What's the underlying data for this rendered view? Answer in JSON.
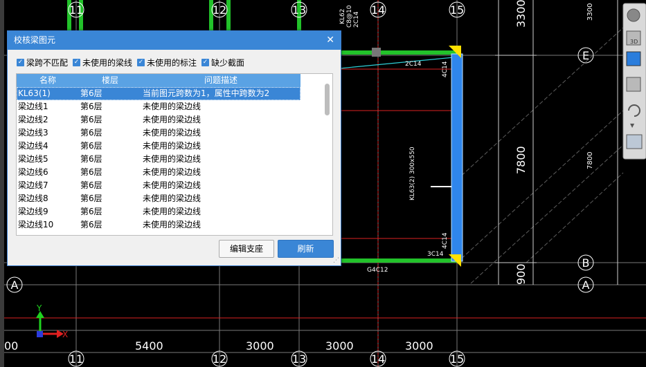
{
  "dialog": {
    "title": "校核梁图元",
    "checks": [
      {
        "label": "梁跨不匹配",
        "checked": true
      },
      {
        "label": "未使用的梁线",
        "checked": true
      },
      {
        "label": "未使用的标注",
        "checked": true
      },
      {
        "label": "缺少截面",
        "checked": true
      }
    ],
    "columns": [
      "名称",
      "楼层",
      "问题描述"
    ],
    "rows": [
      {
        "name": "KL63(1)",
        "floor": "第6层",
        "desc": "当前图元跨数为1，属性中跨数为2",
        "selected": true
      },
      {
        "name": "梁边线1",
        "floor": "第6层",
        "desc": "未使用的梁边线"
      },
      {
        "name": "梁边线2",
        "floor": "第6层",
        "desc": "未使用的梁边线"
      },
      {
        "name": "梁边线3",
        "floor": "第6层",
        "desc": "未使用的梁边线"
      },
      {
        "name": "梁边线4",
        "floor": "第6层",
        "desc": "未使用的梁边线"
      },
      {
        "name": "梁边线5",
        "floor": "第6层",
        "desc": "未使用的梁边线"
      },
      {
        "name": "梁边线6",
        "floor": "第6层",
        "desc": "未使用的梁边线"
      },
      {
        "name": "梁边线7",
        "floor": "第6层",
        "desc": "未使用的梁边线"
      },
      {
        "name": "梁边线8",
        "floor": "第6层",
        "desc": "未使用的梁边线"
      },
      {
        "name": "梁边线9",
        "floor": "第6层",
        "desc": "未使用的梁边线"
      },
      {
        "name": "梁边线10",
        "floor": "第6层",
        "desc": "未使用的梁边线"
      }
    ],
    "buttons": {
      "edit": "编辑支座",
      "refresh": "刷新"
    }
  },
  "cad": {
    "axes_top": [
      "11",
      "12",
      "13",
      "14",
      "15"
    ],
    "axes_bottom": [
      "11",
      "12",
      "13",
      "14",
      "15"
    ],
    "axes_right": [
      "E",
      "B",
      "A"
    ],
    "axis_left": "A",
    "dims_bottom": [
      "00",
      "5400",
      "3000",
      "3000",
      "3000"
    ],
    "dims_right": [
      "3300",
      "7800",
      "900"
    ],
    "dims_right_small": [
      "3300",
      "7800"
    ],
    "beam_label_main": "KL63(2) 300x550",
    "beam_label_small": [
      "2C14",
      "4C14",
      "4C14",
      "3C14",
      "G4C12",
      "3C14"
    ],
    "top_labels": [
      "KL62",
      "C8@10",
      "2C14"
    ],
    "coord_y": "Y",
    "coord_x": "X"
  },
  "toolbar": {
    "icons": [
      "sphere-view-icon",
      "3d-box-icon",
      "front-view-icon",
      "box-view-icon",
      "rotate-icon",
      "more-icon",
      "layers-icon"
    ],
    "label_3d": "3D"
  }
}
